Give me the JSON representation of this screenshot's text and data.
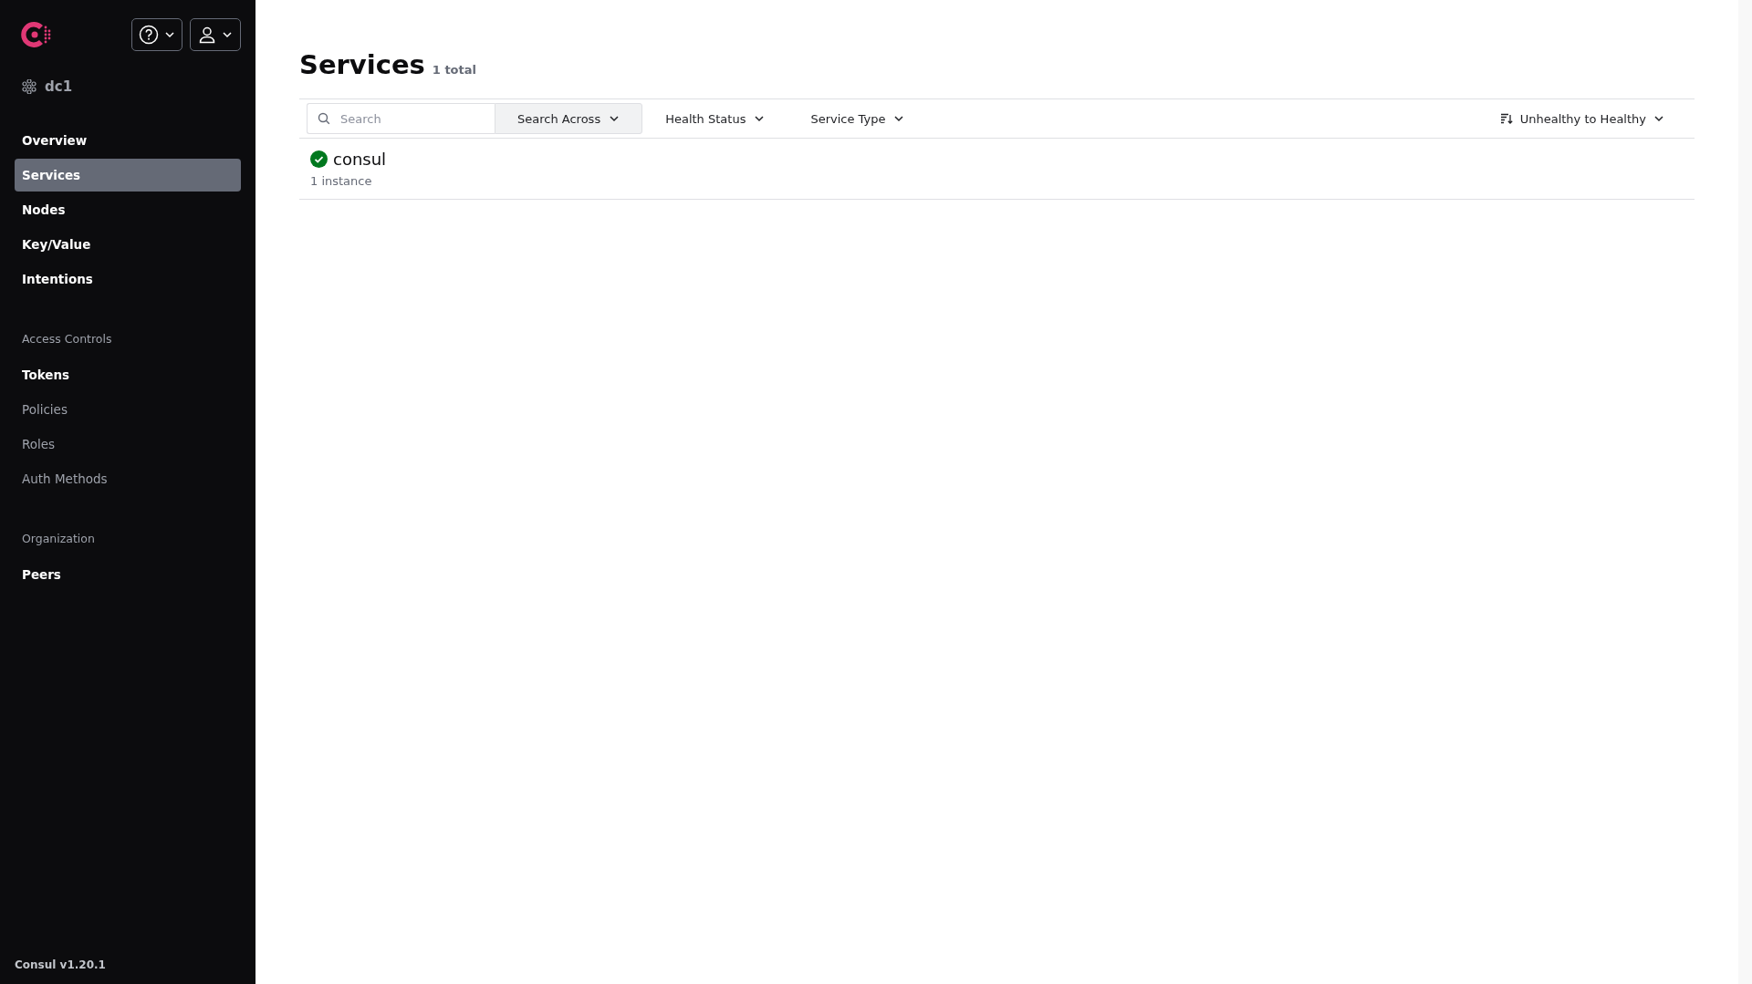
{
  "sidebar": {
    "datacenter": "dc1",
    "sections": [
      {
        "items": [
          {
            "label": "Overview",
            "selected": false,
            "dimmed": false
          },
          {
            "label": "Services",
            "selected": true,
            "dimmed": false
          },
          {
            "label": "Nodes",
            "selected": false,
            "dimmed": false
          },
          {
            "label": "Key/Value",
            "selected": false,
            "dimmed": false
          },
          {
            "label": "Intentions",
            "selected": false,
            "dimmed": false
          }
        ]
      },
      {
        "heading": "Access Controls",
        "items": [
          {
            "label": "Tokens",
            "selected": false,
            "dimmed": false
          },
          {
            "label": "Policies",
            "selected": false,
            "dimmed": true
          },
          {
            "label": "Roles",
            "selected": false,
            "dimmed": true
          },
          {
            "label": "Auth Methods",
            "selected": false,
            "dimmed": true
          }
        ]
      },
      {
        "heading": "Organization",
        "items": [
          {
            "label": "Peers",
            "selected": false,
            "dimmed": false
          }
        ]
      }
    ],
    "version": "Consul v1.20.1"
  },
  "page": {
    "title": "Services",
    "count": "1 total"
  },
  "filters": {
    "search": {
      "placeholder": "Search"
    },
    "dropdowns": [
      {
        "label": "Search Across",
        "kind": "attached"
      },
      {
        "label": "Health Status",
        "kind": "plain"
      },
      {
        "label": "Service Type",
        "kind": "plain"
      }
    ],
    "sort": {
      "label": "Unhealthy to Healthy"
    }
  },
  "services": [
    {
      "name": "consul",
      "instances": "1 instance",
      "healthy": true
    }
  ]
}
